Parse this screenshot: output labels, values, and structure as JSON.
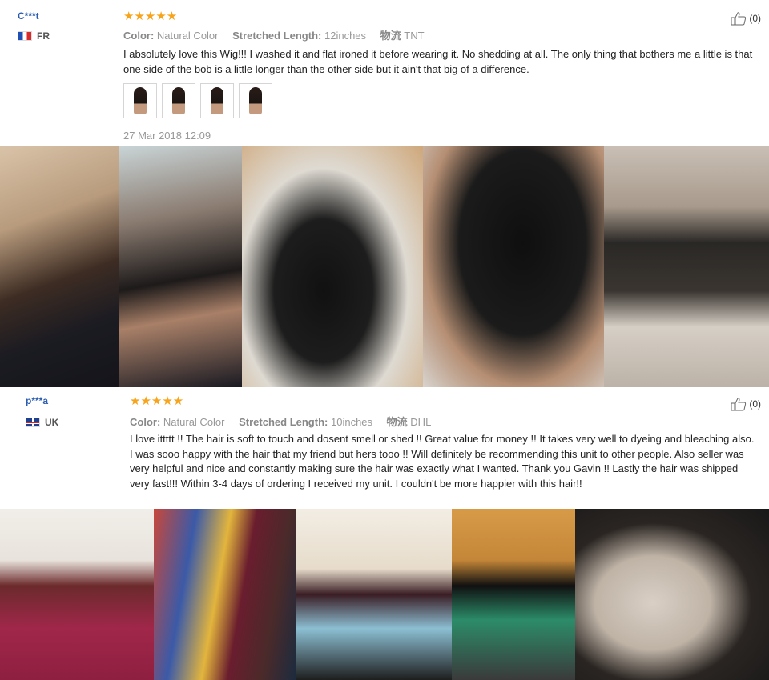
{
  "reviews": [
    {
      "user": "C***t",
      "country": "FR",
      "rating": "★★★★★",
      "color_label": "Color:",
      "color_value": "Natural Color",
      "length_label": "Stretched Length:",
      "length_value": "12inches",
      "shipping_label": "物流",
      "shipping_value": "TNT",
      "helpful": "(0)",
      "text": "I absolutely love this Wig!!! I washed it and flat ironed it before wearing it. No shedding at all. The only thing that bothers me a little is that one side of the bob is a little longer than the other side but it ain't that big of a difference.",
      "date": "27 Mar 2018 12:09"
    },
    {
      "user": "p***a",
      "country": "UK",
      "rating": "★★★★★",
      "color_label": "Color:",
      "color_value": "Natural Color",
      "length_label": "Stretched Length:",
      "length_value": "10inches",
      "shipping_label": "物流",
      "shipping_value": "DHL",
      "helpful": "(0)",
      "text": "I love ittttt !! The hair is soft to touch and dosent smell or shed !! Great value for money !! It takes very well to dyeing and bleaching also. I was sooo happy with the hair that my friend but hers tooo !! Will definitely be recommending this unit to other people. Also seller was very helpful and nice and constantly making sure the hair was exactly what I wanted. Thank you Gavin !! Lastly the hair was shipped very fast!!! Within 3-4 days of ordering I received my unit. I couldn't be more happier with this hair!!"
    }
  ],
  "colors": {
    "star": "#f7a41d",
    "username": "#2a5db0",
    "meta": "#999999"
  },
  "icons": {
    "helpful": "thumbs-up-icon"
  }
}
